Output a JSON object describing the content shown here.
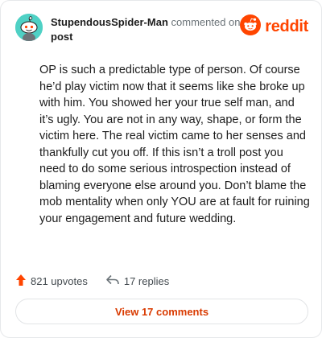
{
  "colors": {
    "accent": "#ff4500",
    "button_text": "#d93a00",
    "avatar_bg": "#4fd1c5"
  },
  "header": {
    "username": "StupendousSpider-Man",
    "action": "commented on",
    "target": "post",
    "brand": "reddit",
    "brand_icon": "reddit-logo-icon",
    "avatar_icon": "snoo-avatar-icon"
  },
  "comment": {
    "body": "OP is such a predictable type of person. Of course he’d play victim now that it seems like she broke up with him. You showed her your true self man, and it’s ugly. You are not in any way, shape, or form the victim here. The real victim came to her senses and thankfully cut you off. If this isn’t a troll post you need to do some serious introspection instead of blaming everyone else around you. Don’t blame the mob mentality when only YOU are at fault for ruining your engagement and future wedding."
  },
  "footer": {
    "upvotes": "821 upvotes",
    "replies": "17 replies",
    "upvote_icon": "upvote-arrow-icon",
    "reply_icon": "reply-arrow-icon"
  },
  "view_button": "View 17 comments"
}
